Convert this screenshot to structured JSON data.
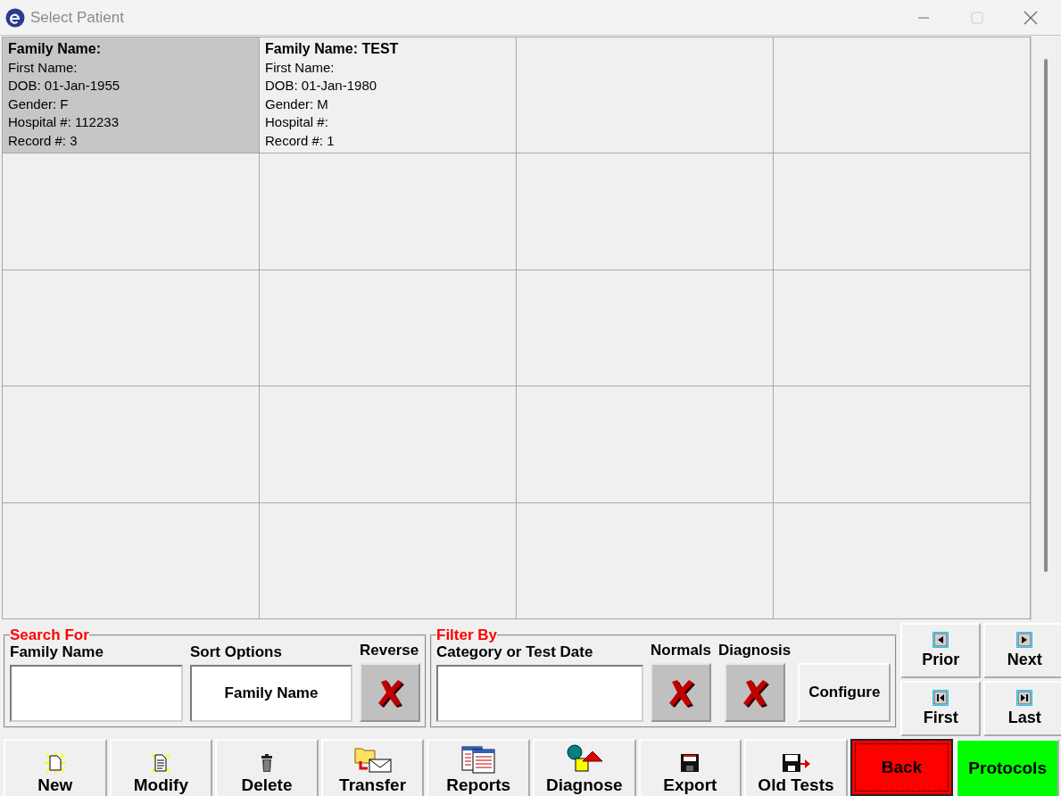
{
  "window": {
    "title": "Select Patient"
  },
  "patients": [
    {
      "selected": true,
      "lines": [
        "Family Name:",
        "First Name:",
        "DOB: 01-Jan-1955",
        "Gender: F",
        "Hospital #: 112233",
        "Record #: 3"
      ]
    },
    {
      "selected": false,
      "lines": [
        "Family Name: TEST",
        "First Name:",
        "DOB: 01-Jan-1980",
        "Gender: M",
        "Hospital #:",
        "Record #: 1"
      ]
    }
  ],
  "search_for": {
    "title": "Search For",
    "family_name": {
      "label": "Family Name"
    },
    "sort_options": {
      "label": "Sort Options",
      "value": "Family Name"
    },
    "reverse": {
      "label": "Reverse"
    }
  },
  "filter_by": {
    "title": "Filter By",
    "category": {
      "label": "Category or Test Date"
    },
    "normals": {
      "label": "Normals"
    },
    "diagnosis": {
      "label": "Diagnosis"
    },
    "configure": "Configure"
  },
  "navigation": [
    {
      "label": "Prior",
      "kind": "prior"
    },
    {
      "label": "Next",
      "kind": "next"
    },
    {
      "label": "First",
      "kind": "first"
    },
    {
      "label": "Last",
      "kind": "last"
    }
  ],
  "toolbar": [
    {
      "label": "New",
      "kind": "new",
      "focused": false
    },
    {
      "label": "Modify",
      "kind": "modify",
      "focused": false
    },
    {
      "label": "Delete",
      "kind": "delete",
      "focused": false
    },
    {
      "label": "Transfer",
      "kind": "transfer",
      "focused": false
    },
    {
      "label": "Reports",
      "kind": "reports",
      "focused": false
    },
    {
      "label": "Diagnose",
      "kind": "diagnose",
      "focused": false
    },
    {
      "label": "Export",
      "kind": "export",
      "focused": false
    },
    {
      "label": "Old Tests",
      "kind": "oldtests",
      "focused": false
    },
    {
      "label": "Back",
      "kind": "plain",
      "color": "#ff0000",
      "focused": true
    },
    {
      "label": "Protocols",
      "kind": "plain",
      "color": "#00ff00",
      "focused": false
    }
  ]
}
